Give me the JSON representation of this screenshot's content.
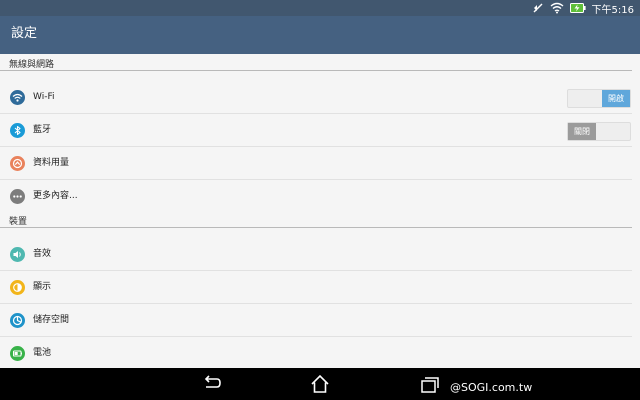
{
  "status_bar": {
    "time": "下午5:16",
    "icons": [
      "mute-icon",
      "wifi-icon",
      "battery-charging-icon"
    ]
  },
  "action_bar": {
    "title": "設定"
  },
  "sections": [
    {
      "header": "無線與網路",
      "items": [
        {
          "label": "Wi-Fi",
          "icon": "wifi-icon",
          "icon_color": "#2f6b9a",
          "toggle": {
            "state": "on",
            "label": "開啟"
          }
        },
        {
          "label": "藍牙",
          "icon": "bluetooth-icon",
          "icon_color": "#1a9bd7",
          "toggle": {
            "state": "off",
            "label": "關閉"
          }
        },
        {
          "label": "資料用量",
          "icon": "data-usage-icon",
          "icon_color": "#e9825c"
        },
        {
          "label": "更多內容...",
          "icon": "more-icon",
          "icon_color": "#7d7d7d"
        }
      ]
    },
    {
      "header": "裝置",
      "items": [
        {
          "label": "音效",
          "icon": "sound-icon",
          "icon_color": "#4fb8b0"
        },
        {
          "label": "顯示",
          "icon": "display-icon",
          "icon_color": "#f2b51a"
        },
        {
          "label": "儲存空間",
          "icon": "storage-icon",
          "icon_color": "#1f93c9"
        },
        {
          "label": "電池",
          "icon": "battery-icon",
          "icon_color": "#38b249"
        }
      ]
    }
  ],
  "nav_bar": {
    "buttons": [
      "back-icon",
      "home-icon",
      "recent-apps-icon"
    ],
    "watermark": "@SOGI.com.tw"
  },
  "colors": {
    "status_bar": "#41576f",
    "action_bar": "#456181",
    "toggle_on": "#5fa7db",
    "toggle_off": "#9b9b9b"
  }
}
